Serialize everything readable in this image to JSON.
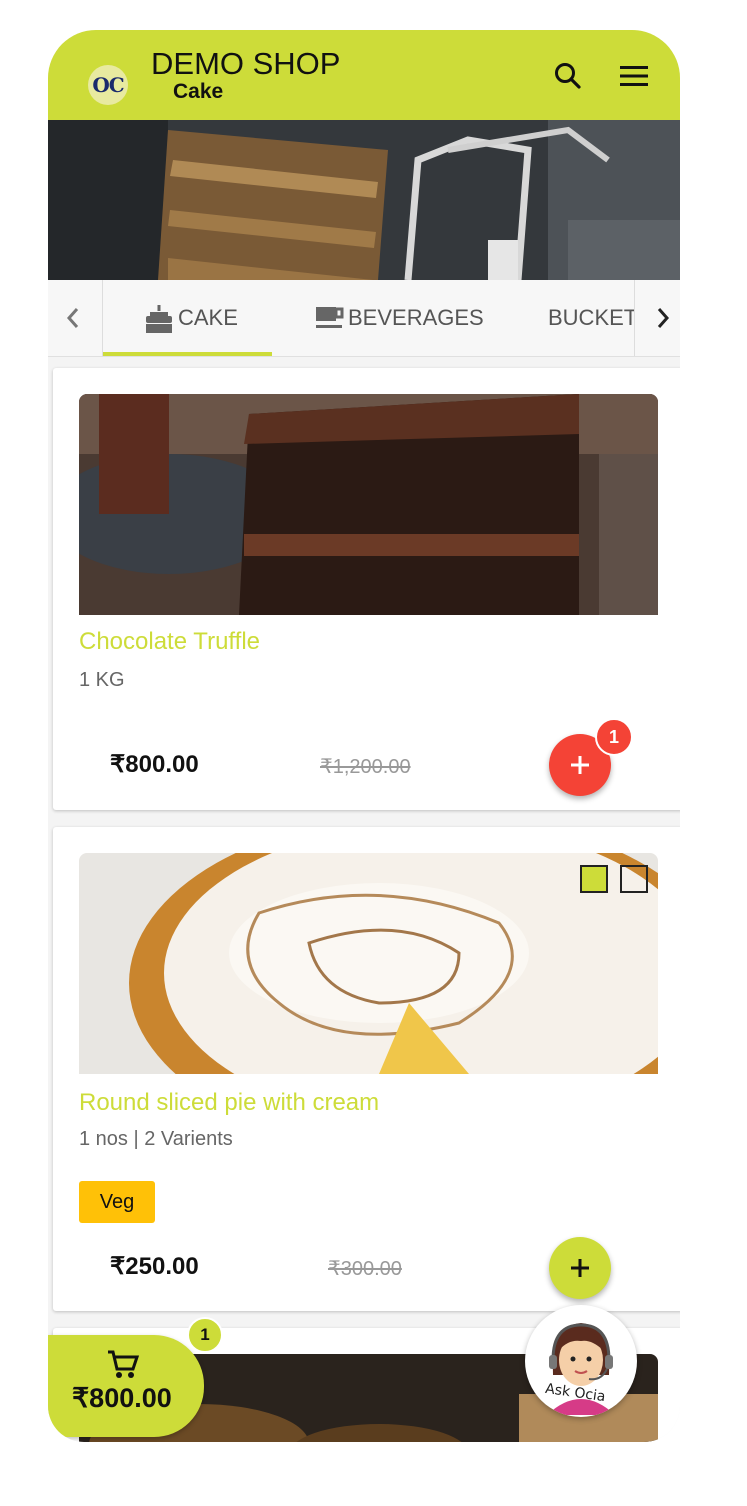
{
  "header": {
    "logo_text": "OC",
    "shop_name": "DEMO SHOP",
    "category": "Cake",
    "search_icon": "search-icon",
    "menu_icon": "menu-icon"
  },
  "tabs": [
    {
      "label": "CAKE",
      "icon": "cake-icon",
      "active": true
    },
    {
      "label": "BEVERAGES",
      "icon": "coffee-icon",
      "active": false
    },
    {
      "label": "BUCKET",
      "icon": "",
      "active": false
    }
  ],
  "products": [
    {
      "name": "Chocolate Truffle",
      "meta": "1 KG",
      "price": "₹800.00",
      "mrp": "₹1,200.00",
      "cart_count": "1"
    },
    {
      "name": "Round sliced pie with cream",
      "meta": "1 nos | 2 Varients",
      "tag": "Veg",
      "price": "₹250.00",
      "mrp": "₹300.00"
    }
  ],
  "cart": {
    "count": "1",
    "total": "₹800.00"
  },
  "assistant": {
    "label": "Ask Ocia"
  },
  "colors": {
    "accent": "#cddc39",
    "fab_red": "#f44336",
    "veg_tag": "#ffc107"
  }
}
